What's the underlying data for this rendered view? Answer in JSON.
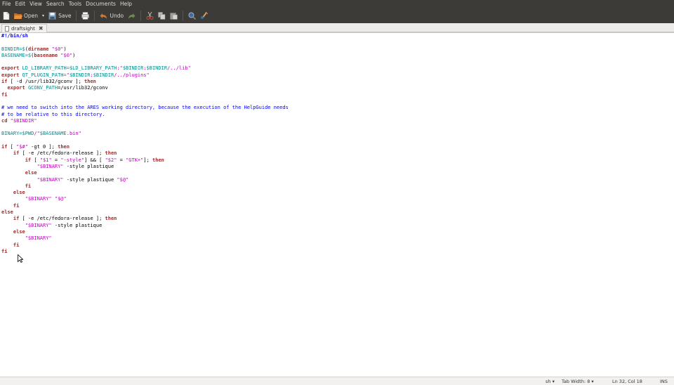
{
  "menu": [
    "File",
    "Edit",
    "View",
    "Search",
    "Tools",
    "Documents",
    "Help"
  ],
  "toolbar": {
    "new_icon": "new-document-icon",
    "open_label": "Open",
    "save_label": "Save",
    "print_icon": "print-icon",
    "undo_label": "Undo",
    "redo_icon": "redo-icon",
    "cut_icon": "cut-icon",
    "copy_icon": "copy-icon",
    "paste_icon": "paste-icon",
    "find_icon": "find-icon",
    "replace_icon": "replace-icon"
  },
  "tab": {
    "title": "draftsight"
  },
  "code_lines": [
    [
      [
        "sheb",
        "#!/bin/sh"
      ]
    ],
    [],
    [
      [
        "v",
        "BINDIR=$"
      ],
      [
        "",
        "("
      ],
      [
        "k",
        "dirname"
      ],
      [
        "s",
        " \"$0\""
      ],
      [
        "",
        ")"
      ]
    ],
    [
      [
        "v",
        "BASENAME=$"
      ],
      [
        "",
        "("
      ],
      [
        "k",
        "basename"
      ],
      [
        "s",
        " \"$0\""
      ],
      [
        "",
        ")"
      ]
    ],
    [],
    [
      [
        "k",
        "export"
      ],
      [
        "v",
        " LD_LIBRARY_PATH=$LD_LIBRARY_PATH"
      ],
      [
        "s",
        ":\""
      ],
      [
        "v",
        "$BINDIR"
      ],
      [
        "s",
        ":"
      ],
      [
        "v",
        "$BINDIR"
      ],
      [
        "s",
        "/../lib\""
      ]
    ],
    [
      [
        "k",
        "export"
      ],
      [
        "v",
        " QT_PLUGIN_PATH="
      ],
      [
        "s",
        "\""
      ],
      [
        "v",
        "$BINDIR"
      ],
      [
        "s",
        ":"
      ],
      [
        "v",
        "$BINDIR"
      ],
      [
        "s",
        "/../plugins\""
      ]
    ],
    [
      [
        "k",
        "if"
      ],
      [
        "",
        " [ -d /usr/lib32/gconv ]; "
      ],
      [
        "k",
        "then"
      ]
    ],
    [
      [
        "",
        "  "
      ],
      [
        "k",
        "export"
      ],
      [
        "v",
        " GCONV_PATH"
      ],
      [
        "",
        "=/usr/lib32/gconv"
      ]
    ],
    [
      [
        "k",
        "fi"
      ]
    ],
    [],
    [
      [
        "c",
        "# we need to switch into the ARES working directory, because the execution of the HelpGuide needs"
      ]
    ],
    [
      [
        "c",
        "# to be relative to this directory."
      ]
    ],
    [
      [
        "k",
        "cd"
      ],
      [
        "s",
        " \"$BINDIR\""
      ]
    ],
    [],
    [
      [
        "v",
        "BINARY=$PWD"
      ],
      [
        "s",
        "/\""
      ],
      [
        "v",
        "$BASENAME"
      ],
      [
        "s",
        ".bin\""
      ]
    ],
    [],
    [
      [
        "k",
        "if"
      ],
      [
        "",
        " [ "
      ],
      [
        "s",
        "\"$#\""
      ],
      [
        "",
        " -gt 0 ]; "
      ],
      [
        "k",
        "then"
      ]
    ],
    [
      [
        "",
        "    "
      ],
      [
        "k",
        "if"
      ],
      [
        "",
        " [ -e /etc/fedora-release ]; "
      ],
      [
        "k",
        "then"
      ]
    ],
    [
      [
        "",
        "        "
      ],
      [
        "k",
        "if"
      ],
      [
        "",
        " [ "
      ],
      [
        "s",
        "\"$1\""
      ],
      [
        "",
        " = "
      ],
      [
        "s",
        "\"-style\""
      ],
      [
        "",
        "] && [ "
      ],
      [
        "s",
        "\"$2\""
      ],
      [
        "",
        " = "
      ],
      [
        "s",
        "\"GTK+\""
      ],
      [
        "",
        "]; "
      ],
      [
        "k",
        "then"
      ]
    ],
    [
      [
        "",
        "            "
      ],
      [
        "s",
        "\"$BINARY\""
      ],
      [
        "",
        " -style plastique"
      ]
    ],
    [
      [
        "",
        "        "
      ],
      [
        "k",
        "else"
      ]
    ],
    [
      [
        "",
        "            "
      ],
      [
        "s",
        "\"$BINARY\""
      ],
      [
        "",
        " -style plastique "
      ],
      [
        "s",
        "\"$@\""
      ]
    ],
    [
      [
        "",
        "        "
      ],
      [
        "k",
        "fi"
      ]
    ],
    [
      [
        "",
        "    "
      ],
      [
        "k",
        "else"
      ]
    ],
    [
      [
        "",
        "        "
      ],
      [
        "s",
        "\"$BINARY\""
      ],
      [
        "",
        " "
      ],
      [
        "s",
        "\"$@\""
      ]
    ],
    [
      [
        "",
        "    "
      ],
      [
        "k",
        "fi"
      ]
    ],
    [
      [
        "k",
        "else"
      ]
    ],
    [
      [
        "",
        "    "
      ],
      [
        "k",
        "if"
      ],
      [
        "",
        " [ -e /etc/fedora-release ]; "
      ],
      [
        "k",
        "then"
      ]
    ],
    [
      [
        "",
        "        "
      ],
      [
        "s",
        "\"$BINARY\""
      ],
      [
        "",
        " -style plastique"
      ]
    ],
    [
      [
        "",
        "    "
      ],
      [
        "k",
        "else"
      ]
    ],
    [
      [
        "",
        "        "
      ],
      [
        "s",
        "\"$BINARY\""
      ]
    ],
    [
      [
        "",
        "    "
      ],
      [
        "k",
        "fi"
      ]
    ],
    [
      [
        "k",
        "fi"
      ]
    ]
  ],
  "status": {
    "language": "sh ▾",
    "tab_width": "Tab Width:  8 ▾",
    "position": "Ln 32, Col 18",
    "mode": "INS"
  }
}
